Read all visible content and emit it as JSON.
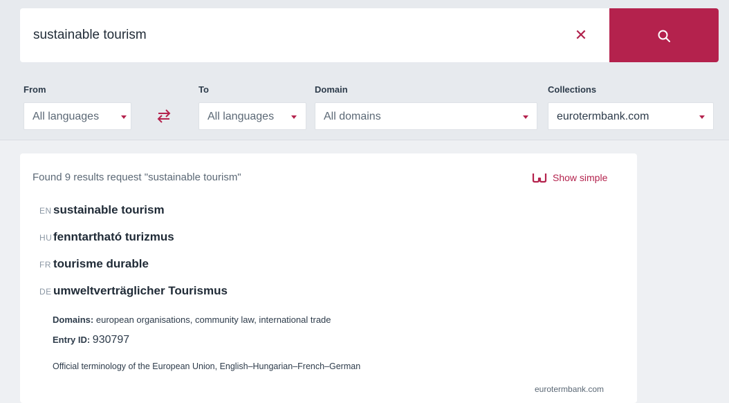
{
  "search": {
    "query": "sustainable tourism",
    "clear_glyph": "✕"
  },
  "filters": {
    "from": {
      "label": "From",
      "value": "All languages"
    },
    "to": {
      "label": "To",
      "value": "All languages"
    },
    "domain": {
      "label": "Domain",
      "value": "All domains"
    },
    "collections": {
      "label": "Collections",
      "value": "eurotermbank.com"
    }
  },
  "results": {
    "summary": "Found 9 results request \"sustainable tourism\"",
    "show_simple_label": "Show simple",
    "terms": [
      {
        "lang": "EN",
        "term": "sustainable tourism"
      },
      {
        "lang": "HU",
        "term": "fenntartható turizmus"
      },
      {
        "lang": "FR",
        "term": "tourisme durable"
      },
      {
        "lang": "DE",
        "term": "umweltverträglicher Tourismus"
      }
    ],
    "domains_label": "Domains:",
    "domains_value": "european organisations, community law, international trade",
    "entry_id_label": "Entry ID:",
    "entry_id_value": "930797",
    "description": "Official terminology of the European Union, English–Hungarian–French–German",
    "source": "eurotermbank.com"
  },
  "colors": {
    "accent": "#b4224d",
    "background": "#eef0f3",
    "panel": "#ffffff"
  },
  "icons": {
    "clear": "close-icon",
    "search": "search-icon",
    "swap": "swap-arrows-icon",
    "show_simple": "glasses-icon",
    "dropdown": "caret-down-icon"
  }
}
